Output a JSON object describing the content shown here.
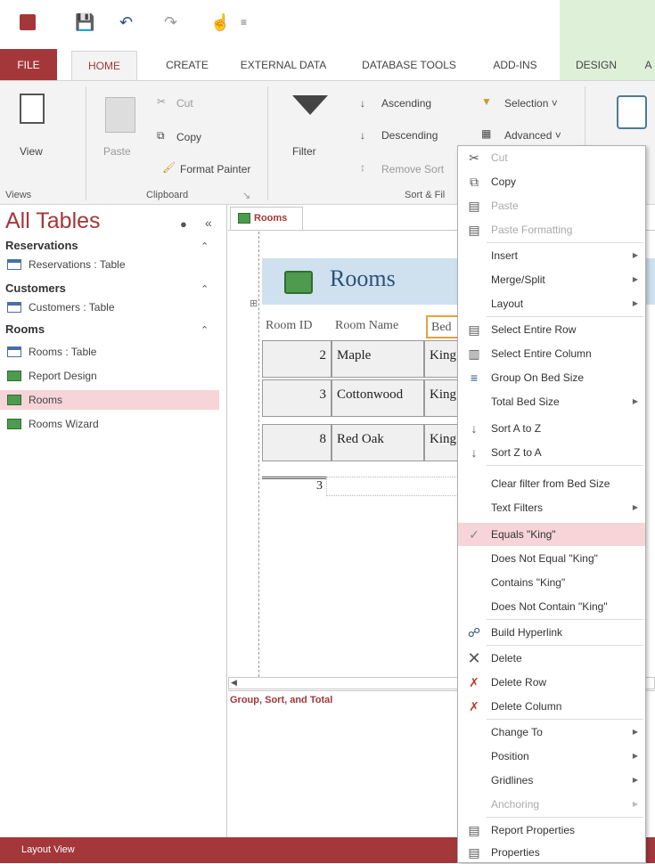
{
  "ribbon_tabs": {
    "file": "FILE",
    "home": "HOME",
    "create": "CREATE",
    "external_data": "EXTERNAL DATA",
    "database_tools": "DATABASE TOOLS",
    "add_ins": "ADD-INS",
    "design": "DESIGN",
    "cut_off": "A"
  },
  "ribbon": {
    "view": "View",
    "paste": "Paste",
    "cut": "Cut",
    "copy": "Copy",
    "format_painter": "Format Painter",
    "filter": "Filter",
    "ascending": "Ascending",
    "descending": "Descending",
    "remove_sort": "Remove Sort",
    "selection": "Selection ˅",
    "advanced": "Advanced ˅",
    "group_views": "Views",
    "group_clipboard": "Clipboard",
    "group_sort_filter": "Sort & Fil"
  },
  "nav": {
    "title": "All Tables",
    "groups": [
      {
        "header": "Reservations",
        "items": [
          "Reservations : Table"
        ]
      },
      {
        "header": "Customers",
        "items": [
          "Customers : Table"
        ]
      },
      {
        "header": "Rooms",
        "items": [
          "Rooms : Table",
          "Report Design",
          "Rooms",
          "Rooms Wizard"
        ]
      }
    ]
  },
  "doc": {
    "tab": "Rooms",
    "report_title": "Rooms",
    "columns": [
      "Room ID",
      "Room Name",
      "Bed"
    ],
    "rows": [
      [
        "2",
        "Maple",
        "King"
      ],
      [
        "3",
        "Cottonwood",
        "King"
      ],
      [
        "8",
        "Red Oak",
        "King"
      ]
    ],
    "count": "3",
    "group_sort_total": "Group, Sort, and Total"
  },
  "status": "Layout View",
  "menu": [
    "Cut",
    "Copy",
    "Paste",
    "Paste Formatting",
    "Insert",
    "Merge/Split",
    "Layout",
    "Select Entire Row",
    "Select Entire Column",
    "Group On Bed Size",
    "Total Bed Size",
    "Sort A to Z",
    "Sort Z to A",
    "Clear filter from Bed Size",
    "Text Filters",
    "Equals \"King\"",
    "Does Not Equal \"King\"",
    "Contains \"King\"",
    "Does Not Contain \"King\"",
    "Build Hyperlink",
    "Delete",
    "Delete Row",
    "Delete Column",
    "Change To",
    "Position",
    "Gridlines",
    "Anchoring",
    "Report Properties",
    "Properties"
  ],
  "colors": {
    "accent": "#a4373a",
    "ribbon_bg": "#f3f3f3",
    "report_header": "#cfe0ef",
    "menu_highlight": "#f6d4d7"
  }
}
